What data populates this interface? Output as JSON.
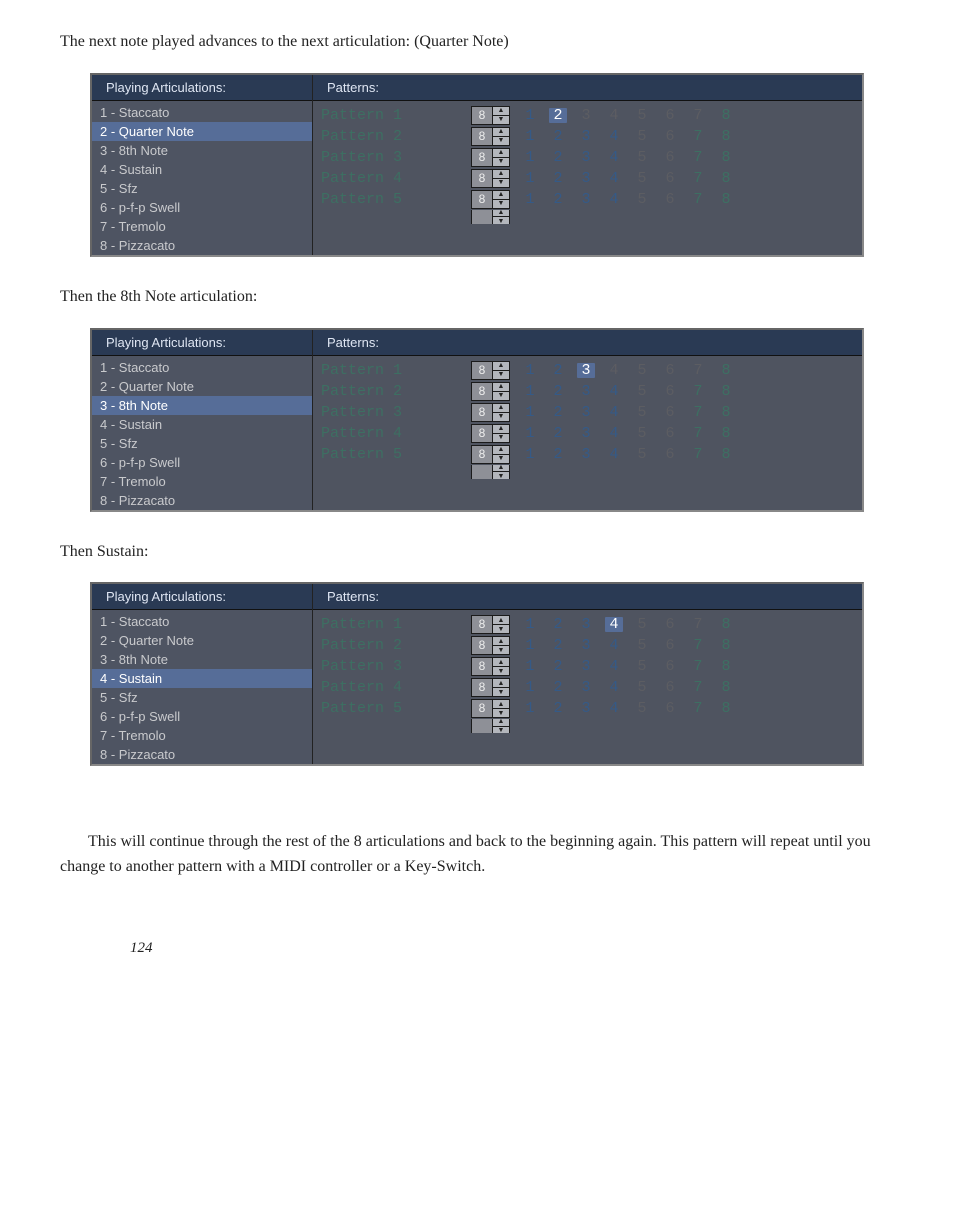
{
  "text": {
    "intro": "The next note played advances to the next articulation: (Quarter Note)",
    "then8th": "Then the 8th Note articulation:",
    "thenSustain": "Then Sustain:",
    "outro": "This will continue through the rest of the 8 articulations and back to the beginning again. This pattern will repeat until you change to another pattern with a MIDI controller or a Key-Switch.",
    "pageNum": "124"
  },
  "headers": {
    "articulations": "Playing Articulations:",
    "patterns": "Patterns:"
  },
  "articulations": [
    "1 - Staccato",
    "2 - Quarter Note",
    "3 - 8th Note",
    "4 - Sustain",
    "5 - Sfz",
    "6 - p-f-p Swell",
    "7 - Tremolo",
    "8 - Pizzacato"
  ],
  "patternRows": [
    {
      "name": "Pattern 1",
      "spin": "8"
    },
    {
      "name": "Pattern 2",
      "spin": "8"
    },
    {
      "name": "Pattern 3",
      "spin": "8"
    },
    {
      "name": "Pattern 4",
      "spin": "8"
    },
    {
      "name": "Pattern 5",
      "spin": "8"
    }
  ],
  "nums": [
    "1",
    "2",
    "3",
    "4",
    "5",
    "6",
    "7",
    "8"
  ],
  "panels": [
    {
      "selectedIndex": 1,
      "rowHighlights": [
        1,
        -1,
        -1,
        -1,
        -1
      ]
    },
    {
      "selectedIndex": 2,
      "rowHighlights": [
        2,
        -1,
        -1,
        -1,
        -1
      ]
    },
    {
      "selectedIndex": 3,
      "rowHighlights": [
        3,
        -1,
        -1,
        -1,
        -1
      ]
    }
  ]
}
